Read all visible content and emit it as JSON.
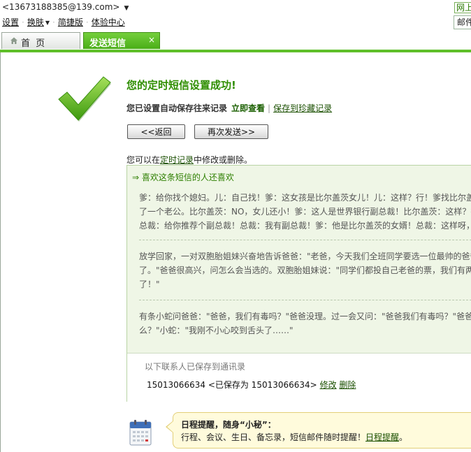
{
  "topbar": {
    "account": "<13673188385@139.com>",
    "nav": [
      {
        "label": "设置"
      },
      {
        "label": "换肤"
      },
      {
        "label": "简捷版"
      },
      {
        "label": "体验中心"
      }
    ],
    "login_link": "网上",
    "mail_search": "邮件"
  },
  "tabs": {
    "home": "首 页",
    "send_sms": "发送短信",
    "close": "×"
  },
  "result": {
    "title": "您的定时短信设置成功!",
    "saved_text": "您已设置自动保存往来记录",
    "view_now": "立即查看",
    "separator": "|",
    "save_favorite": "保存到珍藏记录"
  },
  "buttons": {
    "back": "<<返回",
    "resend": "再次发送>>"
  },
  "modify": {
    "prefix": "您可以在",
    "link": "定时记录",
    "suffix": "中修改或删除。"
  },
  "recommend": {
    "title": "⇒ 喜欢这条短信的人还喜欢",
    "jokes": [
      {
        "lines": [
          "爹：给你找个媳妇。儿：自己找！爹：这女孩是比尔盖茨女儿！儿：这样？行！爹找比尔盖茨：给你女儿找",
          "了一个老公。比尔盖茨：NO，女儿还小！爹：这人是世界银行副总裁！比尔盖茨：这样？行！爹找世界银行",
          "总裁：给你推荐个副总裁！总裁：我有副总裁！爹：他是比尔盖茨的女婿！总裁：这样呀，行！"
        ]
      },
      {
        "lines": [
          "放学回家，一对双胞胎姐妹兴奋地告诉爸爸：\"老爸，今天我们全班同学要选一位最帅的爸爸，结果您当选",
          "了。\"爸爸很高兴，问怎么会当选的。双胞胎姐妹说：\"同学们都投自己老爸的票，我们有两票，所以您当选",
          "了！\""
        ]
      },
      {
        "lines": [
          "有条小蛇问爸爸：\"爸爸，我们有毒吗？\"爸爸没理。过一会又问：\"爸爸我们有毒吗？\"爸爸说：\"问这干什",
          "么？\"小蛇：\"我刚不小心咬到舌头了……\""
        ]
      }
    ]
  },
  "contacts": {
    "title": "以下联系人已保存到通讯录",
    "number": "15013066634",
    "saved_as": "<已保存为 15013066634>",
    "edit": "修改",
    "delete": "删除"
  },
  "reminder": {
    "title": "日程提醒，随身“小秘”：",
    "text": "行程、会议、生日、备忘录，短信邮件随时提醒！",
    "link": "日程提醒",
    "end": "。"
  },
  "colors": {
    "accent_green": "#5fbf2a",
    "title_green": "#2f8e00",
    "panel_bg": "#eff6e6",
    "bubble_bg": "#fffbdc"
  },
  "icons": {
    "check": "check-icon",
    "home": "home-icon",
    "calendar": "calendar-icon"
  }
}
